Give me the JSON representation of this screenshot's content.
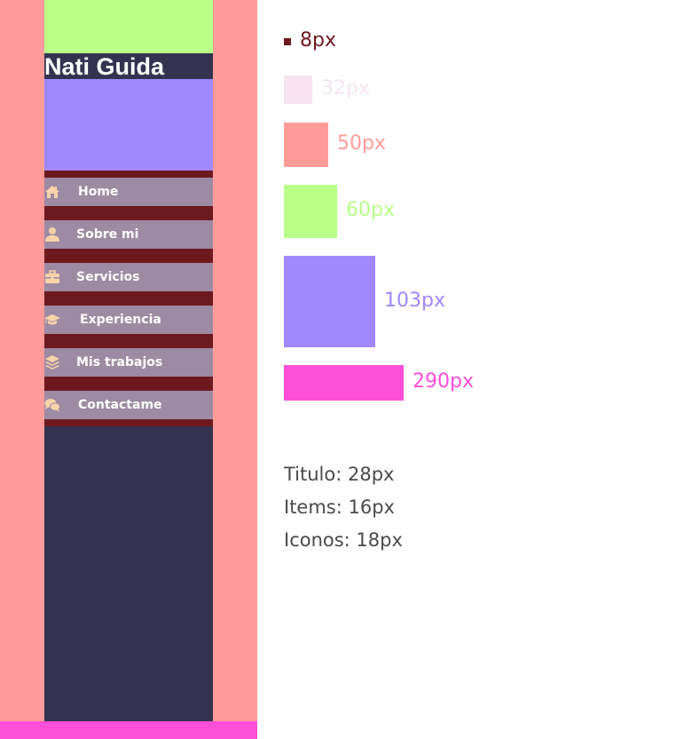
{
  "sidebar": {
    "title": "Nati Guida",
    "items": [
      {
        "label": "Home",
        "icon": "home-icon"
      },
      {
        "label": "Sobre mi",
        "icon": "user-icon"
      },
      {
        "label": "Servicios",
        "icon": "briefcase-icon"
      },
      {
        "label": "Experiencia",
        "icon": "graduation-cap-icon"
      },
      {
        "label": "Mis trabajos",
        "icon": "layers-icon"
      },
      {
        "label": "Contactame",
        "icon": "comments-icon"
      }
    ]
  },
  "legend": [
    {
      "label": "8px",
      "color": "#6d1a1f"
    },
    {
      "label": "32px",
      "color": "#f7e4f0"
    },
    {
      "label": "50px",
      "color": "#ff9b99"
    },
    {
      "label": "60px",
      "color": "#b9ff88"
    },
    {
      "label": "103px",
      "color": "#a088ff"
    },
    {
      "label": "290px",
      "color": "#ff4fd8"
    }
  ],
  "specs": {
    "title_size": "Titulo: 28px",
    "items_size": "Items: 16px",
    "icons_size": "Iconos: 18px"
  },
  "colors": {
    "frame": "#ff9b99",
    "sidebar_bg": "#33334f",
    "top_block": "#b9ff88",
    "purple_block": "#a088ff",
    "nav_bg": "#6d1a1f",
    "nav_item_bg": "#9d8aa3",
    "icon_color": "#f6d3a9",
    "bottom_bar": "#ff4fd8",
    "spec_text": "#4a4a4a"
  }
}
